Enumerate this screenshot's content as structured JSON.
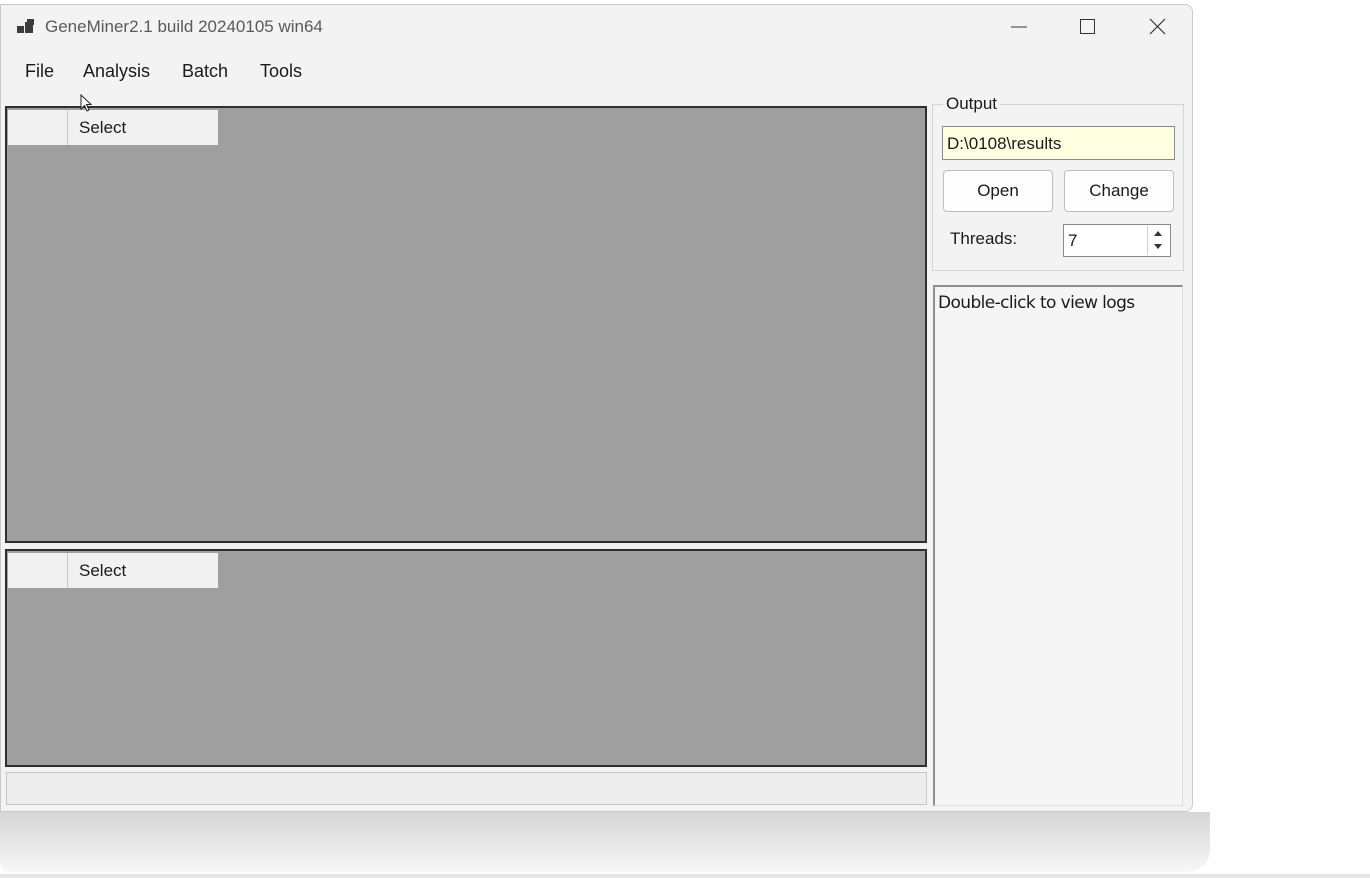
{
  "window": {
    "title": "GeneMiner2.1 build 20240105 win64"
  },
  "menu": {
    "items": [
      "File",
      "Analysis",
      "Batch",
      "Tools"
    ]
  },
  "grids": {
    "top": {
      "column_header": "Select"
    },
    "bottom": {
      "column_header": "Select"
    }
  },
  "output": {
    "group_label": "Output",
    "path": "D:\\0108\\results",
    "open_label": "Open",
    "change_label": "Change",
    "threads_label": "Threads:",
    "threads_value": "7"
  },
  "log": {
    "hint": "Double-click to view logs"
  },
  "icons": {
    "app": "app-icon",
    "minimize": "minimize-icon",
    "maximize": "maximize-icon",
    "close": "close-icon",
    "cursor": "mouse-cursor-icon",
    "spin_up": "spin-up-icon",
    "spin_down": "spin-down-icon"
  }
}
